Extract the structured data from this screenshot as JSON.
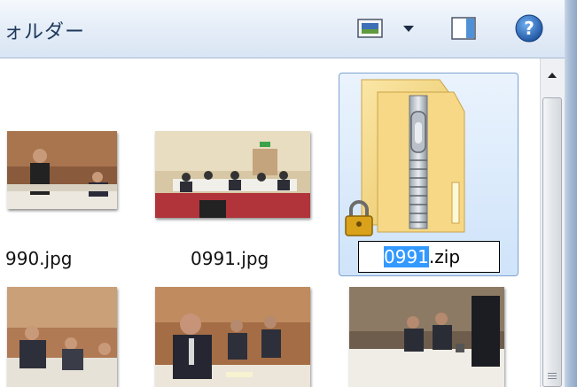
{
  "toolbar": {
    "folder_label": "ォルダー",
    "icons": [
      "change-view-icon",
      "view-menu-arrow-icon",
      "preview-pane-icon",
      "help-icon"
    ]
  },
  "files": [
    {
      "name": "990.jpg",
      "type": "image"
    },
    {
      "name": "0991.jpg",
      "type": "image"
    },
    {
      "name_selected_part": "0991",
      "name_rest": ".zip",
      "type": "encrypted-zip-folder",
      "state": "renaming"
    },
    {
      "type": "image"
    },
    {
      "type": "image"
    },
    {
      "type": "image"
    }
  ],
  "colors": {
    "selection_highlight": "#3399ff",
    "selected_item_bg": "#cfe3fa",
    "toolbar_text": "#1e395b"
  }
}
